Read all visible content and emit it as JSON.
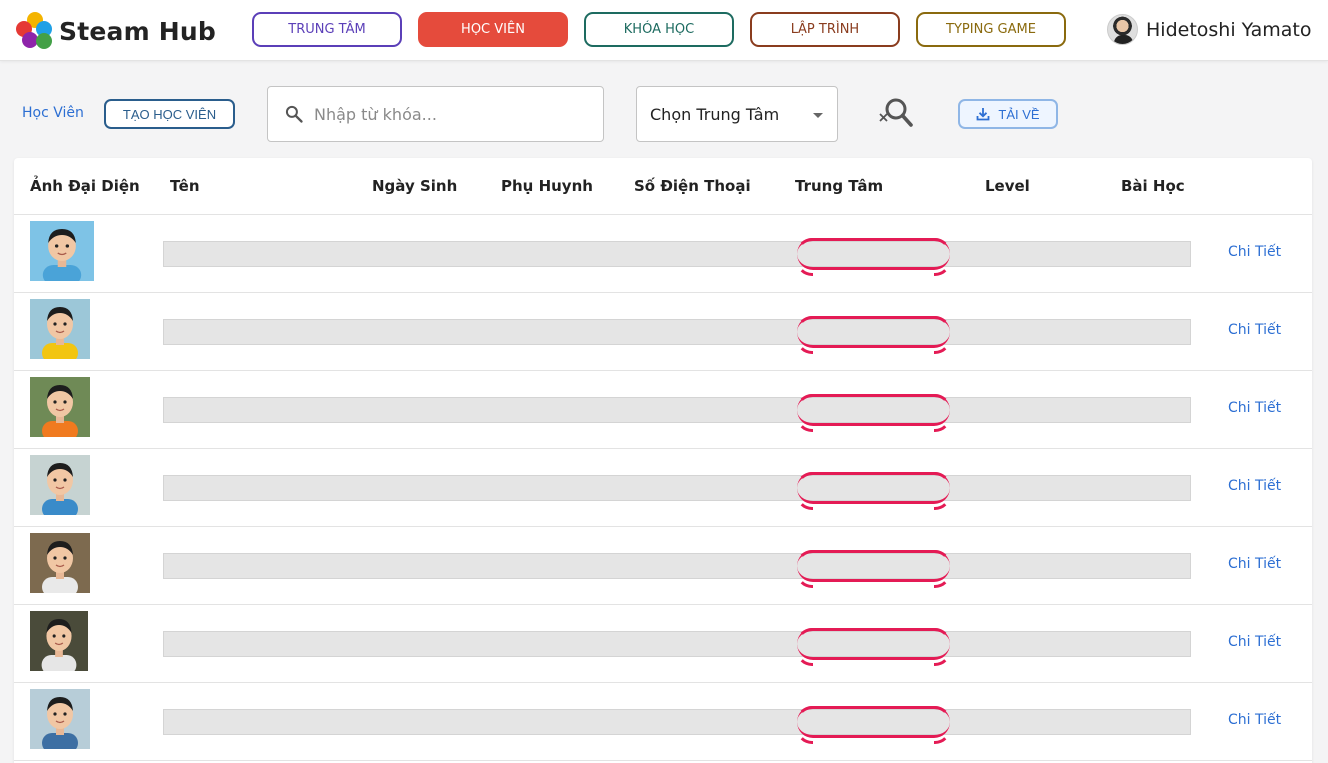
{
  "brand": {
    "name": "Steam Hub",
    "logo_colors": [
      "#f4b400",
      "#1fa0e6",
      "#e53935",
      "#43a047",
      "#8e24aa"
    ]
  },
  "nav": [
    {
      "label": "TRUNG TÂM",
      "color": "#5b3fb8",
      "active": false
    },
    {
      "label": "HỌC VIÊN",
      "color": "#e54b3c",
      "active": true
    },
    {
      "label": "KHÓA HỌC",
      "color": "#1d6b60",
      "active": false
    },
    {
      "label": "LẬP TRÌNH",
      "color": "#8a3c1e",
      "active": false
    },
    {
      "label": "TYPING GAME",
      "color": "#8a6a0e",
      "active": false
    }
  ],
  "user": {
    "name": "Hidetoshi Yamato",
    "icon": "user-avatar"
  },
  "toolbar": {
    "breadcrumb": "Học Viên",
    "create_label": "TẠO HỌC VIÊN",
    "search_placeholder": "Nhập từ khóa...",
    "search_value": "",
    "center_select": "Chọn Trung Tâm",
    "clear_search_icon": "search-clear-icon",
    "download_label": "TẢI VỀ",
    "download_icon": "download-icon"
  },
  "table": {
    "headers": [
      "Ảnh Đại Diện",
      "Tên",
      "Ngày Sinh",
      "Phụ Huynh",
      "Số Điện Thoại",
      "Trung Tâm",
      "Level",
      "Bài Học"
    ],
    "rows": [
      {
        "photo": "student-photo-1",
        "bg": "#7ec3e6",
        "shirt": "#4aa3d8",
        "action": "Chi Tiết"
      },
      {
        "photo": "student-photo-2",
        "bg": "#9cc7d8",
        "shirt": "#f2c511",
        "action": "Chi Tiết"
      },
      {
        "photo": "student-photo-3",
        "bg": "#6f8a56",
        "shirt": "#f07a1f",
        "action": "Chi Tiết"
      },
      {
        "photo": "student-photo-4",
        "bg": "#c6d3d2",
        "shirt": "#3a8bc9",
        "action": "Chi Tiết"
      },
      {
        "photo": "student-photo-5",
        "bg": "#7d6a4f",
        "shirt": "#e9e9e9",
        "action": "Chi Tiết"
      },
      {
        "photo": "student-photo-6",
        "bg": "#4a4b3a",
        "shirt": "#e6e6e6",
        "action": "Chi Tiết"
      },
      {
        "photo": "student-photo-7",
        "bg": "#b7cdd8",
        "shirt": "#3d6fa3",
        "action": "Chi Tiết"
      }
    ]
  },
  "colors": {
    "accent_blue": "#2d6fd3",
    "skeleton": "#e5e5e5",
    "center_pill": "#e41b55"
  }
}
